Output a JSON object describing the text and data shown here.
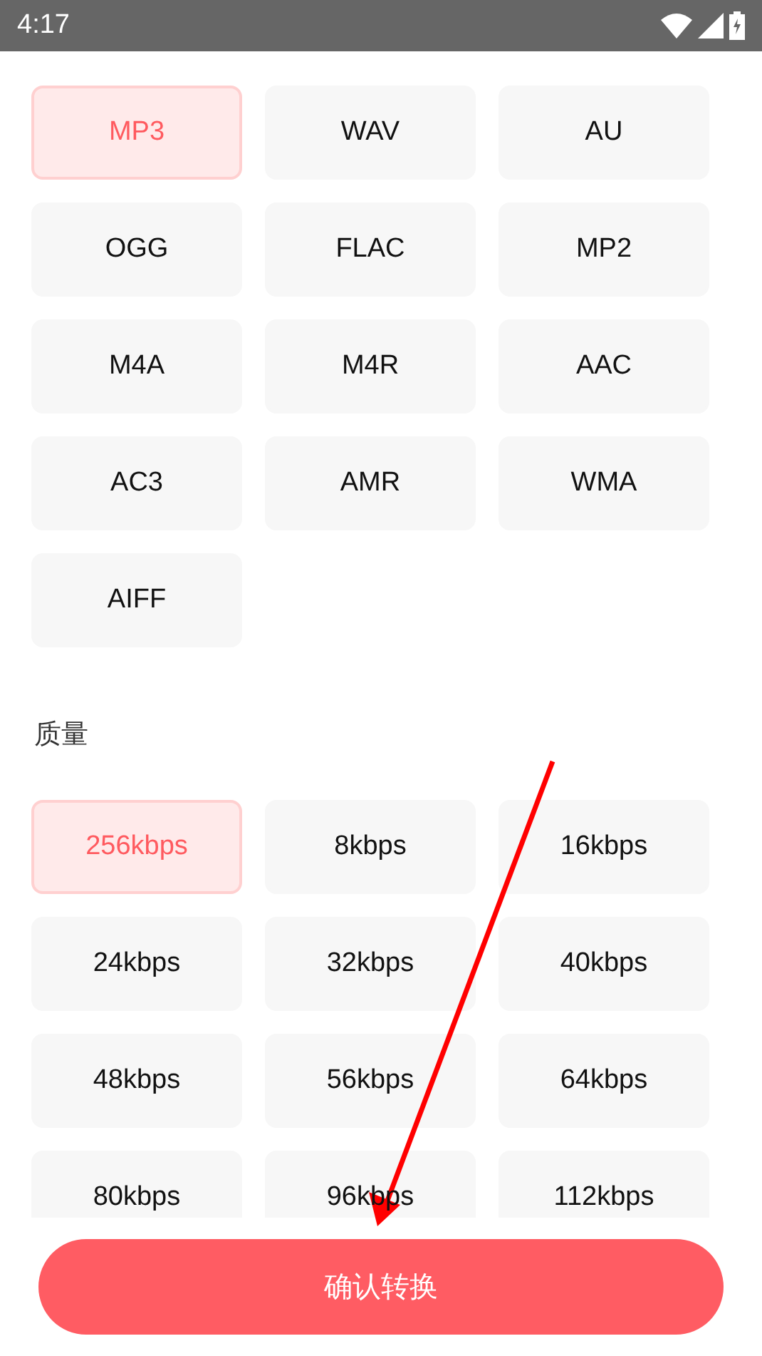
{
  "status_bar": {
    "time": "4:17"
  },
  "formats": [
    {
      "label": "MP3",
      "selected": true
    },
    {
      "label": "WAV",
      "selected": false
    },
    {
      "label": "AU",
      "selected": false
    },
    {
      "label": "OGG",
      "selected": false
    },
    {
      "label": "FLAC",
      "selected": false
    },
    {
      "label": "MP2",
      "selected": false
    },
    {
      "label": "M4A",
      "selected": false
    },
    {
      "label": "M4R",
      "selected": false
    },
    {
      "label": "AAC",
      "selected": false
    },
    {
      "label": "AC3",
      "selected": false
    },
    {
      "label": "AMR",
      "selected": false
    },
    {
      "label": "WMA",
      "selected": false
    },
    {
      "label": "AIFF",
      "selected": false
    }
  ],
  "quality": {
    "label": "质量",
    "options": [
      {
        "label": "256kbps",
        "selected": true
      },
      {
        "label": "8kbps",
        "selected": false
      },
      {
        "label": "16kbps",
        "selected": false
      },
      {
        "label": "24kbps",
        "selected": false
      },
      {
        "label": "32kbps",
        "selected": false
      },
      {
        "label": "40kbps",
        "selected": false
      },
      {
        "label": "48kbps",
        "selected": false
      },
      {
        "label": "56kbps",
        "selected": false
      },
      {
        "label": "64kbps",
        "selected": false
      },
      {
        "label": "80kbps",
        "selected": false
      },
      {
        "label": "96kbps",
        "selected": false
      },
      {
        "label": "112kbps",
        "selected": false
      }
    ]
  },
  "confirm_button": "确认转换"
}
